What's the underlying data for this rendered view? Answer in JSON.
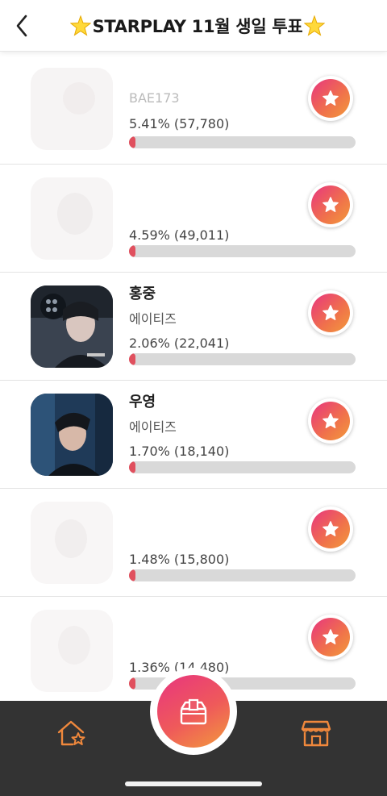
{
  "header": {
    "title": "STARPLAY 11월 생일 투표",
    "back_icon": "chevron-left-icon",
    "decoration_icon": "sparkle-star-icon"
  },
  "candidates": [
    {
      "name": "",
      "group": "BAE173",
      "percent_text": "5.41% (57,780)",
      "percent": 5.41,
      "blurred": true
    },
    {
      "name": "",
      "group": "",
      "percent_text": "4.59% (49,011)",
      "percent": 4.59,
      "blurred": true
    },
    {
      "name": "홍중",
      "group": "에이티즈",
      "percent_text": "2.06% (22,041)",
      "percent": 2.06,
      "blurred": false
    },
    {
      "name": "우영",
      "group": "에이티즈",
      "percent_text": "1.70% (18,140)",
      "percent": 1.7,
      "blurred": false
    },
    {
      "name": "",
      "group": "",
      "percent_text": "1.48% (15,800)",
      "percent": 1.48,
      "blurred": true
    },
    {
      "name": "",
      "group": "",
      "percent_text": "1.36% (14,480)",
      "percent": 1.36,
      "blurred": true
    }
  ],
  "colors": {
    "accent_pink": "#e8357f",
    "accent_orange": "#f29a3c",
    "bar_fill": "#e0505e",
    "bar_track": "#d9d9d9",
    "nav_background": "#333333",
    "nav_icon": "#f0883c"
  },
  "bottom_nav": {
    "left_icon": "home-star-icon",
    "center_icon": "ballot-box-icon",
    "right_icon": "store-icon"
  }
}
